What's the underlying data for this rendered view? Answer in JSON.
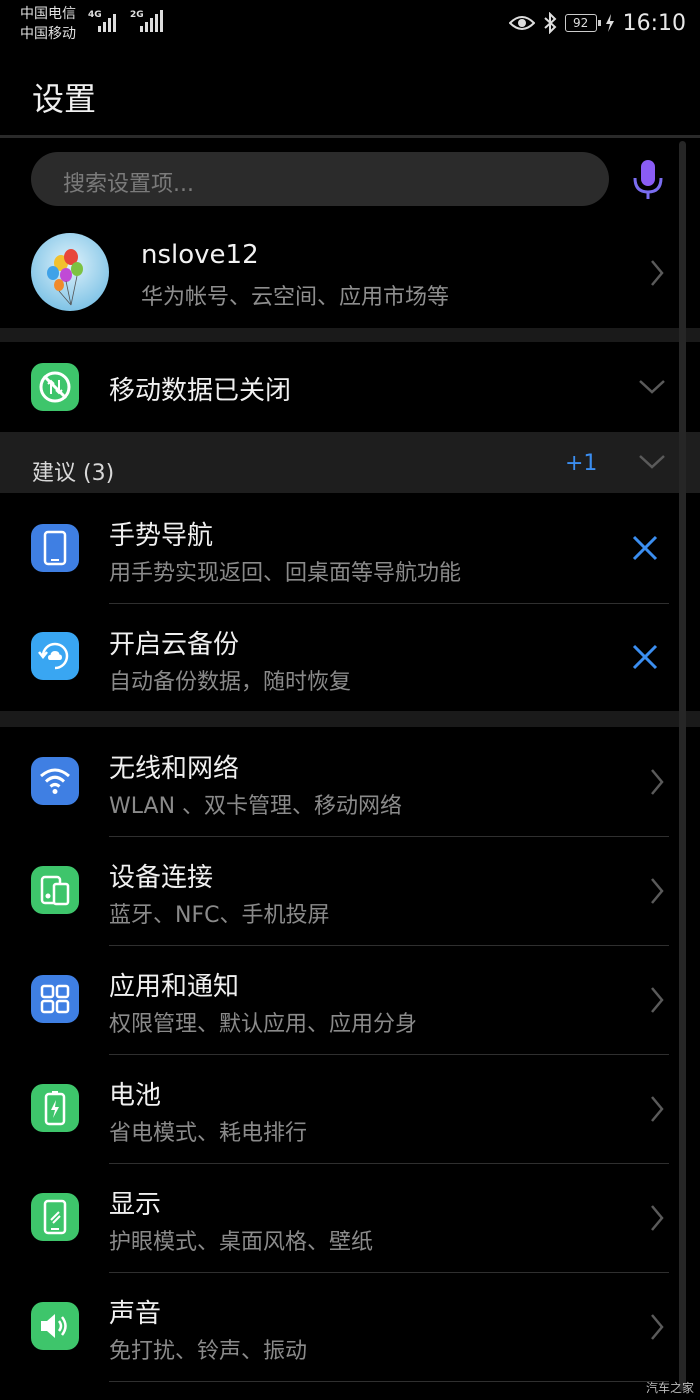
{
  "status_bar": {
    "carrier_1": "中国电信",
    "carrier_2": "中国移动",
    "network_1": "4G",
    "network_2": "2G",
    "battery": "92",
    "time": "16:10"
  },
  "header": {
    "title": "设置"
  },
  "search": {
    "placeholder": "搜索设置项..."
  },
  "account": {
    "name": "nslove12",
    "subtitle": "华为帐号、云空间、应用市场等"
  },
  "mobile_data": {
    "label": "移动数据已关闭"
  },
  "suggestions": {
    "label": "建议 (3)",
    "extra_count": "+1",
    "items": [
      {
        "title": "手势导航",
        "subtitle": "用手势实现返回、回桌面等导航功能",
        "icon": "phone-icon"
      },
      {
        "title": "开启云备份",
        "subtitle": "自动备份数据，随时恢复",
        "icon": "cloud-backup-icon"
      }
    ]
  },
  "settings": [
    {
      "title": "无线和网络",
      "subtitle": "WLAN 、双卡管理、移动网络",
      "icon": "wifi-icon"
    },
    {
      "title": "设备连接",
      "subtitle": "蓝牙、NFC、手机投屏",
      "icon": "device-connection-icon"
    },
    {
      "title": "应用和通知",
      "subtitle": "权限管理、默认应用、应用分身",
      "icon": "apps-grid-icon"
    },
    {
      "title": "电池",
      "subtitle": "省电模式、耗电排行",
      "icon": "battery-icon"
    },
    {
      "title": "显示",
      "subtitle": "护眼模式、桌面风格、壁纸",
      "icon": "display-icon"
    },
    {
      "title": "声音",
      "subtitle": "免打扰、铃声、振动",
      "icon": "sound-icon"
    }
  ],
  "watermark": "汽车之家",
  "colors": {
    "accent_blue": "#3b8ef0",
    "icon_green": "#3ec56b",
    "icon_blue": "#3f7fe3",
    "mic_purple": "#8a5cf5"
  }
}
